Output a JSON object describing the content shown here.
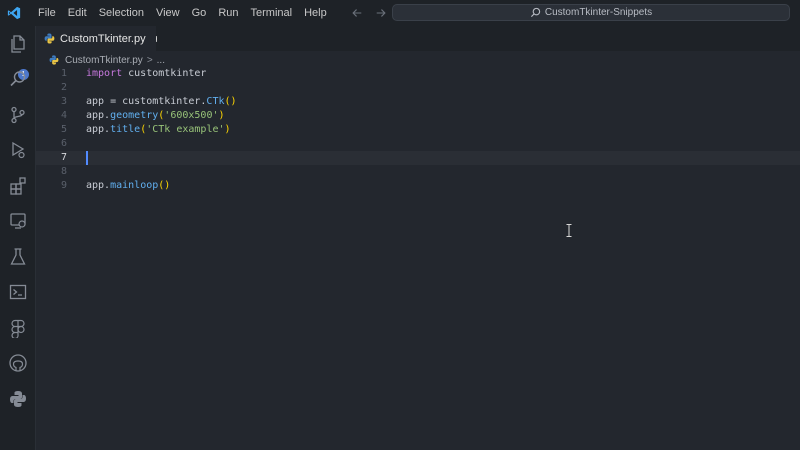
{
  "menu": [
    "File",
    "Edit",
    "Selection",
    "View",
    "Go",
    "Run",
    "Terminal",
    "Help"
  ],
  "command_center": {
    "text": "CustomTkinter-Snippets"
  },
  "activity_bar": {
    "explorer_badge": "1",
    "icons": [
      "files-icon",
      "search-icon",
      "source-control-icon",
      "run-debug-icon",
      "extensions-icon",
      "remote-explorer-icon",
      "testing-icon",
      "terminal-icon",
      "figma-icon",
      "github-icon",
      "python-icon"
    ]
  },
  "tab": {
    "label": "CustomTkinter.py",
    "modified": true
  },
  "breadcrumb": {
    "file": "CustomTkinter.py",
    "separator": ">",
    "more": "..."
  },
  "editor": {
    "current_line": 7,
    "lines": [
      {
        "n": "1"
      },
      {
        "n": "2"
      },
      {
        "n": "3"
      },
      {
        "n": "4"
      },
      {
        "n": "5"
      },
      {
        "n": "6"
      },
      {
        "n": "7"
      },
      {
        "n": "8"
      },
      {
        "n": "9"
      }
    ],
    "tokens": {
      "l1_kw": "import",
      "l1_rest": " customtkinter",
      "l3_a": "app = customtkinter.",
      "l3_fn": "CTk",
      "l3_p": "()",
      "l4_a": "app.",
      "l4_fn": "geometry",
      "l4_p1": "(",
      "l4_s": "'600x500'",
      "l4_p2": ")",
      "l5_a": "app.",
      "l5_fn": "title",
      "l5_p1": "(",
      "l5_s": "'CTk example'",
      "l5_p2": ")",
      "l9_a": "app.",
      "l9_fn": "mainloop",
      "l9_p": "()"
    }
  }
}
